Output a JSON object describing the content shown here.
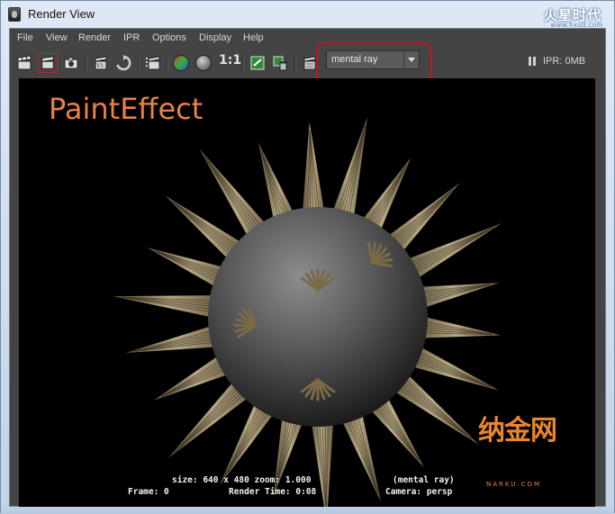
{
  "window": {
    "title": "Render View",
    "logo_text": "火星时代",
    "logo_sub": "www.hxsd.com"
  },
  "menu": [
    "File",
    "View",
    "Render",
    "IPR",
    "Options",
    "Display",
    "Help"
  ],
  "toolbar": {
    "icons": [
      "render-frame-icon",
      "render-region-icon",
      "snapshot-icon",
      "ipr-render-icon",
      "refresh-ipr-icon",
      "render-sequence-icon",
      "color-channels-icon",
      "alpha-channel-icon",
      "display-settings-icon",
      "keep-image-icon",
      "remove-image-icon",
      "render-settings-icon"
    ],
    "ratio_label": "1:1",
    "renderer_value": "mental ray",
    "ipr_memory": "IPR: 0MB"
  },
  "viewport": {
    "overlay_label": "PaintEffect",
    "info": {
      "size_line": "size: 640 x 480 zoom: 1.000",
      "renderer_line": "(mental ray)",
      "frame_line": "Frame: 0",
      "time_line": "Render Time: 0:08",
      "camera_line": "Camera: persp"
    }
  },
  "watermark": {
    "main": "纳金网",
    "sub": "NARKU.COM"
  },
  "colors": {
    "highlight": "#c4131b",
    "overlay_label": "#e6824a",
    "watermark": "#e9862c"
  }
}
